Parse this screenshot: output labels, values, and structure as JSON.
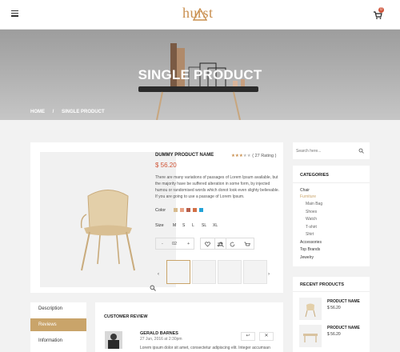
{
  "header": {
    "logo_text": "hurst",
    "cart_count": "0"
  },
  "hero": {
    "title": "SINGLE PRODUCT",
    "breadcrumb": [
      "HOME",
      "/",
      "SINGLE PRODUCT"
    ]
  },
  "product": {
    "name": "DUMMY PRODUCT NAME",
    "rating_text": "( 27 Rating )",
    "stars_filled": 3,
    "stars_total": 5,
    "price": "$ 56.20",
    "description": "There are many variations of passages of Lorem Ipsum available, but the majority have be suffered alteration in some form, by injected humou or randomised words which donot look even slighty believable. If you are going to use a passage of Lorem Ipsum.",
    "color_label": "Color",
    "colors": [
      "#d7bb8e",
      "#e8a285",
      "#b85f4c",
      "#d27046",
      "#23a3d8"
    ],
    "size_label": "Size",
    "sizes": [
      "M",
      "S",
      "L",
      "SL",
      "XL"
    ],
    "quantity": {
      "minus": "-",
      "value": "02",
      "plus": "+"
    }
  },
  "tabs": [
    "Description",
    "Reviews",
    "Information"
  ],
  "active_tab": "Reviews",
  "review": {
    "heading": "CUSTOMER REVIEW",
    "author": "GERALD BARNES",
    "date": "27 Jun, 2016 at 2:30pm",
    "text": "Lorem ipsum dolor sit amet, consectetur adipiscing elit. Integer accumsan"
  },
  "sidebar": {
    "search_placeholder": "Search here...",
    "categories_title": "CATEGORIES",
    "categories": [
      {
        "label": "Chair",
        "level": 0
      },
      {
        "label": "Furniture",
        "level": 0,
        "highlight": true
      },
      {
        "label": "Main Bag",
        "level": 1
      },
      {
        "label": "Shoes",
        "level": 1
      },
      {
        "label": "Watch",
        "level": 1
      },
      {
        "label": "T-shirt",
        "level": 1
      },
      {
        "label": "Shirt",
        "level": 1
      },
      {
        "label": "Accessories",
        "level": 0
      },
      {
        "label": "Top Brands",
        "level": 0
      },
      {
        "label": "Jewelry",
        "level": 0
      }
    ],
    "recent_title": "RECENT PRODUCTS",
    "recent": [
      {
        "name": "PRODUCT NAME",
        "price": "$ 56.20"
      },
      {
        "name": "PRODUCT NAME",
        "price": "$ 56.20"
      }
    ]
  },
  "colors": {
    "accent": "#c9a46a",
    "price": "#d05436",
    "brand": "#c98f4f"
  }
}
